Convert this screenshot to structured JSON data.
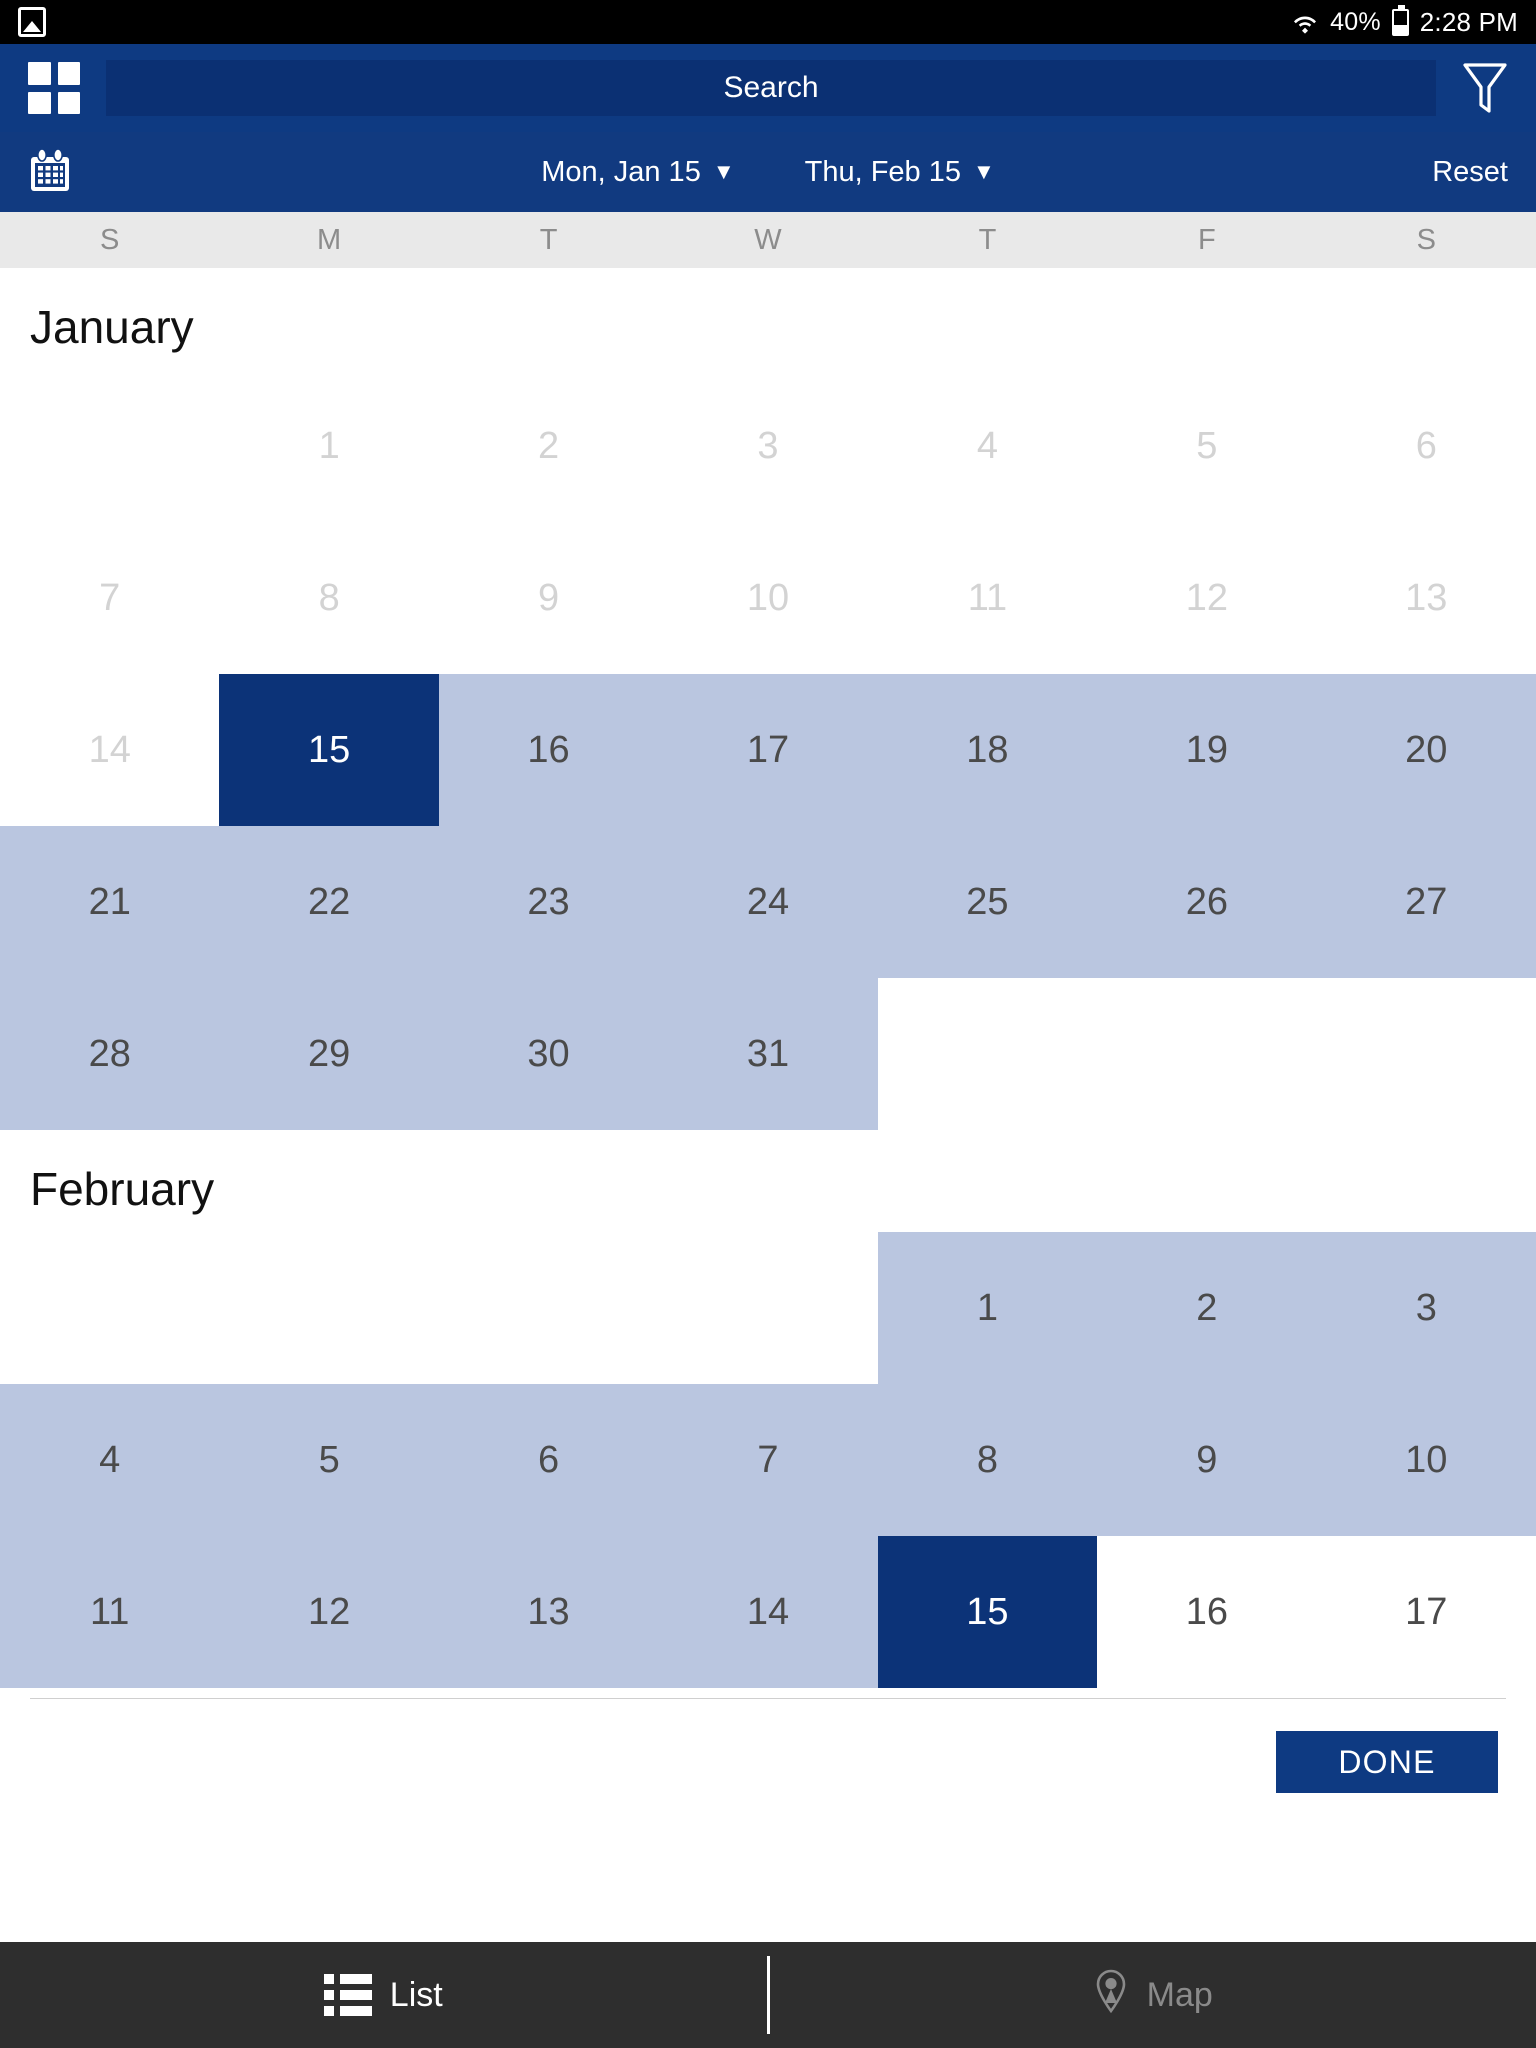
{
  "status_bar": {
    "photo_icon": "photo-icon",
    "wifi_icon": "wifi-icon",
    "battery_percent": "40%",
    "battery_icon": "battery-icon",
    "time": "2:28 PM"
  },
  "header": {
    "grid_icon": "grid-apps-icon",
    "search_placeholder": "Search",
    "search_value": "",
    "filter_icon": "funnel-filter-icon"
  },
  "date_bar": {
    "calendar_icon": "calendar-icon",
    "start_date": "Mon, Jan 15",
    "end_date": "Thu, Feb 15",
    "caret": "▼",
    "reset_label": "Reset"
  },
  "weekdays": [
    "S",
    "M",
    "T",
    "W",
    "T",
    "F",
    "S"
  ],
  "calendar": {
    "months": [
      {
        "name": "January",
        "weeks": [
          [
            {
              "label": "",
              "state": "empty"
            },
            {
              "label": "1",
              "state": "disabled"
            },
            {
              "label": "2",
              "state": "disabled"
            },
            {
              "label": "3",
              "state": "disabled"
            },
            {
              "label": "4",
              "state": "disabled"
            },
            {
              "label": "5",
              "state": "disabled"
            },
            {
              "label": "6",
              "state": "disabled"
            }
          ],
          [
            {
              "label": "7",
              "state": "disabled"
            },
            {
              "label": "8",
              "state": "disabled"
            },
            {
              "label": "9",
              "state": "disabled"
            },
            {
              "label": "10",
              "state": "disabled"
            },
            {
              "label": "11",
              "state": "disabled"
            },
            {
              "label": "12",
              "state": "disabled"
            },
            {
              "label": "13",
              "state": "disabled"
            }
          ],
          [
            {
              "label": "14",
              "state": "disabled"
            },
            {
              "label": "15",
              "state": "selected"
            },
            {
              "label": "16",
              "state": "in-range"
            },
            {
              "label": "17",
              "state": "in-range"
            },
            {
              "label": "18",
              "state": "in-range"
            },
            {
              "label": "19",
              "state": "in-range"
            },
            {
              "label": "20",
              "state": "in-range"
            }
          ],
          [
            {
              "label": "21",
              "state": "in-range"
            },
            {
              "label": "22",
              "state": "in-range"
            },
            {
              "label": "23",
              "state": "in-range"
            },
            {
              "label": "24",
              "state": "in-range"
            },
            {
              "label": "25",
              "state": "in-range"
            },
            {
              "label": "26",
              "state": "in-range"
            },
            {
              "label": "27",
              "state": "in-range"
            }
          ],
          [
            {
              "label": "28",
              "state": "in-range"
            },
            {
              "label": "29",
              "state": "in-range"
            },
            {
              "label": "30",
              "state": "in-range"
            },
            {
              "label": "31",
              "state": "in-range"
            },
            {
              "label": "",
              "state": "empty"
            },
            {
              "label": "",
              "state": "empty"
            },
            {
              "label": "",
              "state": "empty"
            }
          ]
        ]
      },
      {
        "name": "February",
        "weeks": [
          [
            {
              "label": "",
              "state": "empty"
            },
            {
              "label": "",
              "state": "empty"
            },
            {
              "label": "",
              "state": "empty"
            },
            {
              "label": "",
              "state": "empty"
            },
            {
              "label": "1",
              "state": "in-range"
            },
            {
              "label": "2",
              "state": "in-range"
            },
            {
              "label": "3",
              "state": "in-range"
            }
          ],
          [
            {
              "label": "4",
              "state": "in-range"
            },
            {
              "label": "5",
              "state": "in-range"
            },
            {
              "label": "6",
              "state": "in-range"
            },
            {
              "label": "7",
              "state": "in-range"
            },
            {
              "label": "8",
              "state": "in-range"
            },
            {
              "label": "9",
              "state": "in-range"
            },
            {
              "label": "10",
              "state": "in-range"
            }
          ],
          [
            {
              "label": "11",
              "state": "in-range"
            },
            {
              "label": "12",
              "state": "in-range"
            },
            {
              "label": "13",
              "state": "in-range"
            },
            {
              "label": "14",
              "state": "in-range"
            },
            {
              "label": "15",
              "state": "selected"
            },
            {
              "label": "16",
              "state": "normal"
            },
            {
              "label": "17",
              "state": "normal"
            }
          ]
        ]
      }
    ]
  },
  "footer": {
    "done_label": "DONE"
  },
  "bottom_nav": {
    "items": [
      {
        "label": "List",
        "icon": "list-icon",
        "active": true
      },
      {
        "label": "Map",
        "icon": "map-pin-icon",
        "active": false
      }
    ]
  },
  "colors": {
    "header_blue": "#0e3a82",
    "search_field_blue": "#0b3073",
    "date_bar_blue": "#113a80",
    "selected_blue": "#0c3378",
    "range_blue": "#bac6e0",
    "weekday_bg": "#e9e9e9",
    "weekday_text": "#8c8c8c",
    "day_text": "#4a4a4a",
    "disabled_text": "#d3d3d3",
    "nav_bg": "#2e2e2e",
    "nav_inactive": "#8a8a8a",
    "status_bg": "#000000"
  }
}
